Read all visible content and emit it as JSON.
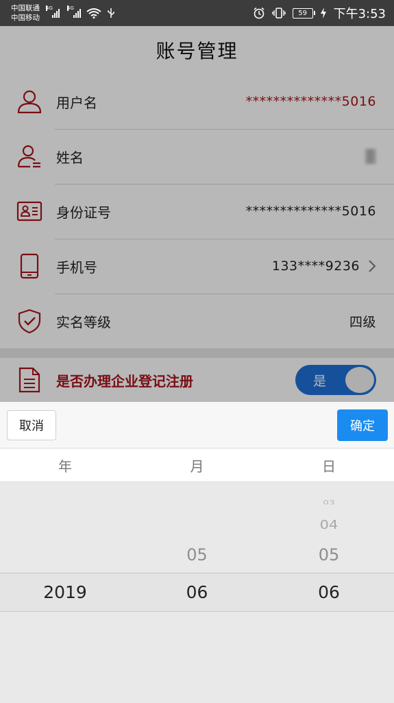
{
  "status_bar": {
    "carrier_1": "中国联通",
    "carrier_2": "中国移动",
    "net_1": "4G",
    "net_2": "4G",
    "battery": "59",
    "time": "下午3:53",
    "icons": [
      "signal-icon",
      "wifi-icon",
      "usb-icon",
      "alarm-icon",
      "vibrate-icon",
      "battery-icon",
      "charging-icon"
    ]
  },
  "header": {
    "title": "账号管理"
  },
  "account_rows": [
    {
      "label": "用户名",
      "value": "**************5016",
      "icon": "user-icon"
    },
    {
      "label": "姓名",
      "value": "",
      "icon": "user-card-icon"
    },
    {
      "label": "身份证号",
      "value": "**************5016",
      "icon": "id-card-icon"
    },
    {
      "label": "手机号",
      "value": "133****9236",
      "icon": "phone-icon"
    },
    {
      "label": "实名等级",
      "value": "四级",
      "icon": "shield-check-icon"
    }
  ],
  "company": {
    "label": "是否办理企业登记注册",
    "toggle_text": "是",
    "toggle_on": true,
    "icon": "document-icon"
  },
  "picker": {
    "cancel": "取消",
    "confirm": "确定",
    "headers": {
      "year": "年",
      "month": "月",
      "day": "日"
    },
    "year": {
      "selected": "2019"
    },
    "month": {
      "selected": "06",
      "above": [
        "05"
      ]
    },
    "day": {
      "selected": "06",
      "above": [
        "05",
        "04",
        "03"
      ]
    }
  },
  "colors": {
    "accent_red": "#a8141c",
    "primary_blue": "#1a8cf0",
    "toggle_blue": "#1f6fd6"
  }
}
